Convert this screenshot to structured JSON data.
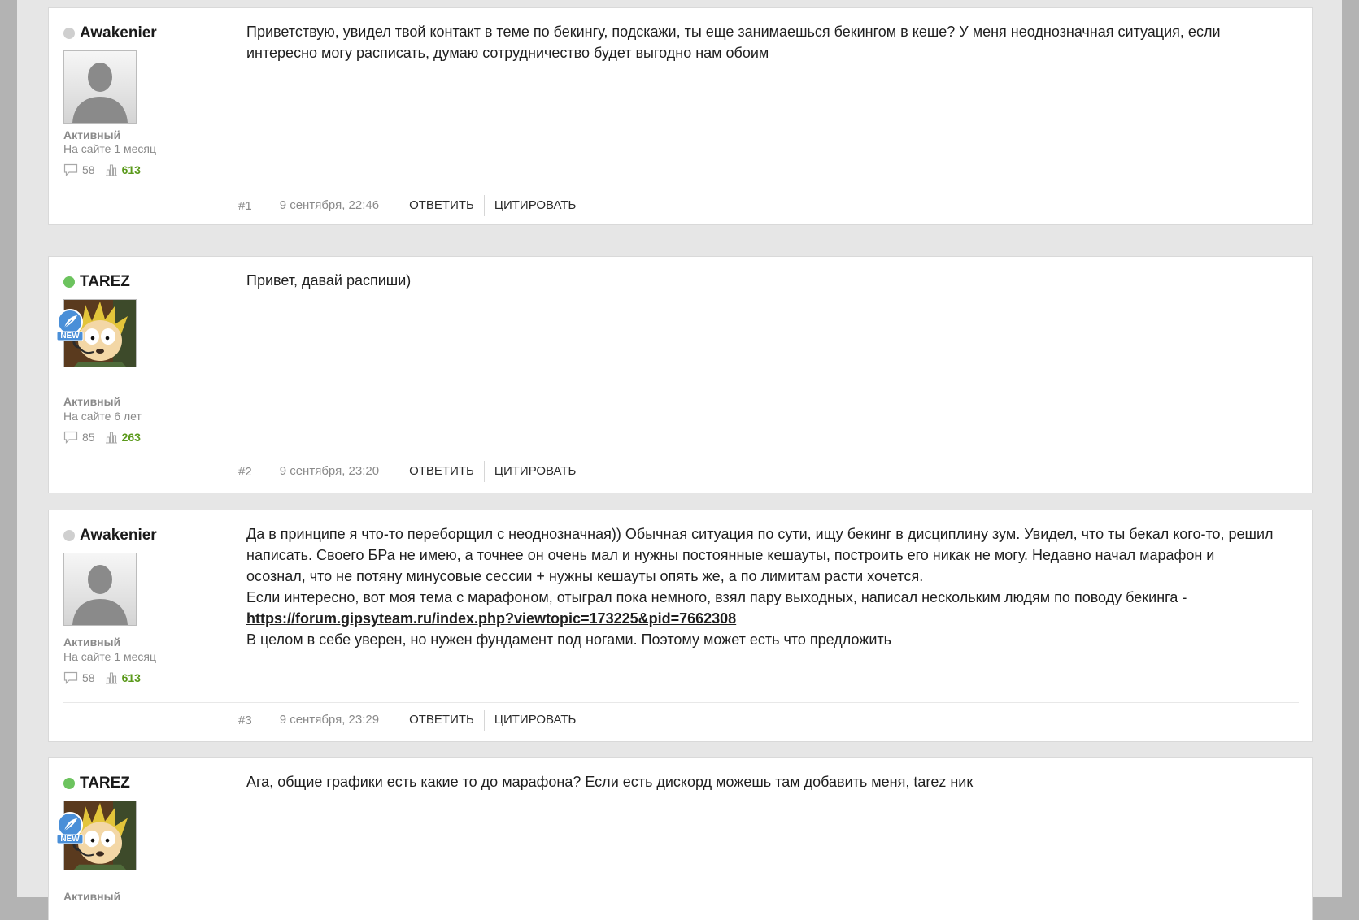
{
  "colors": {
    "online": "#6cc35e",
    "offline": "#cfcfcf",
    "likes": "#5b9a1c"
  },
  "posts": [
    {
      "author": {
        "name": "Awakenier",
        "online": false,
        "avatar": "default-avatar",
        "new_badge": false
      },
      "role": "Активный",
      "tenure": "На сайте 1 месяц",
      "message_count": "58",
      "likes": "613",
      "content": {
        "p1": "Приветствую, увидел твой контакт в теме по бекингу, подскажи, ты еще занимаешься бекингом в кеше? У меня неоднозначная ситуация, если интересно могу расписать, думаю сотрудничество будет выгодно нам обоим"
      },
      "number": "#1",
      "date": "9 сентября, 22:46",
      "reply_label": "Ответить",
      "quote_label": "Цитировать"
    },
    {
      "author": {
        "name": "TAREZ",
        "online": true,
        "avatar": "cartoon-avatar",
        "new_badge": true,
        "badge_text": "NEW"
      },
      "role": "Активный",
      "tenure": "На сайте 6 лет",
      "message_count": "85",
      "likes": "263",
      "content": {
        "p1": "Привет, давай распиши)"
      },
      "number": "#2",
      "date": "9 сентября, 23:20",
      "reply_label": "Ответить",
      "quote_label": "Цитировать"
    },
    {
      "author": {
        "name": "Awakenier",
        "online": false,
        "avatar": "default-avatar",
        "new_badge": false
      },
      "role": "Активный",
      "tenure": "На сайте 1 месяц",
      "message_count": "58",
      "likes": "613",
      "content": {
        "p1": "Да в принципе я что-то переборщил с неоднозначная)) Обычная ситуация по сути, ищу бекинг в дисциплину зум. Увидел, что ты бекал кого-то, решил написать. Своего БРа не имею, а точнее он очень мал и нужны постоянные кешауты, построить его никак не могу. Недавно начал марафон и осознал, что не потяну минусовые сессии + нужны кешауты опять же, а по лимитам расти хочется.",
        "p2": "Если интересно, вот моя тема с марафоном, отыграл пока немного, взял пару выходных, написал нескольким людям по поводу бекинга -",
        "link": "https://forum.gipsyteam.ru/index.php?viewtopic=173225&pid=7662308",
        "p3": "В целом в себе уверен, но нужен фундамент под ногами. Поэтому может есть что предложить"
      },
      "number": "#3",
      "date": "9 сентября, 23:29",
      "reply_label": "Ответить",
      "quote_label": "Цитировать"
    },
    {
      "author": {
        "name": "TAREZ",
        "online": true,
        "avatar": "cartoon-avatar",
        "new_badge": true,
        "badge_text": "NEW"
      },
      "role": "Активный",
      "content": {
        "p1": "Ага, общие графики есть какие то до марафона? Если есть дискорд можешь там добавить меня, tarez ник"
      }
    }
  ]
}
